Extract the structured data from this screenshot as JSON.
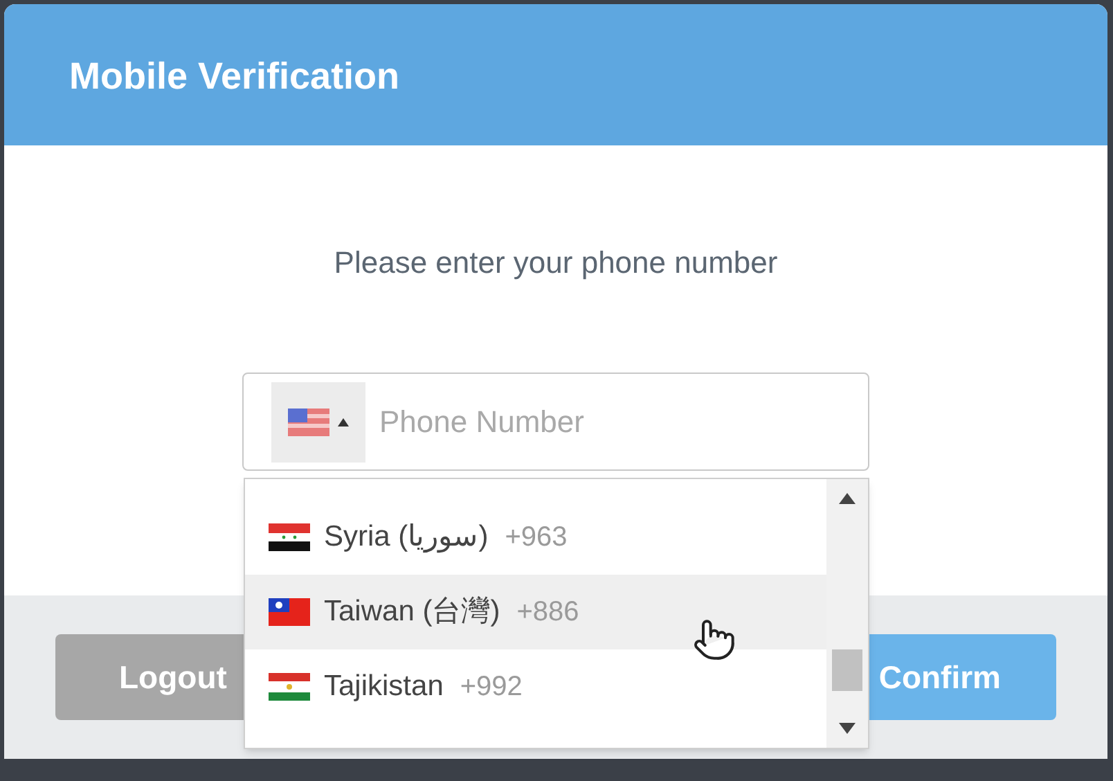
{
  "dialog": {
    "title": "Mobile Verification",
    "prompt": "Please enter your phone number"
  },
  "phone_field": {
    "placeholder": "Phone Number",
    "country_picker": {
      "kind": "us",
      "expanded": true
    }
  },
  "country_list": [
    {
      "name": "Syria (سوريا)",
      "code": "+963",
      "kind": "syria",
      "highlighted": false
    },
    {
      "name": "Taiwan (台灣)",
      "code": "+886",
      "kind": "taiwan",
      "highlighted": true
    },
    {
      "name": "Tajikistan",
      "code": "+992",
      "kind": "tajikistan",
      "highlighted": false
    }
  ],
  "buttons": {
    "logout": "Logout",
    "confirm": "Confirm"
  }
}
